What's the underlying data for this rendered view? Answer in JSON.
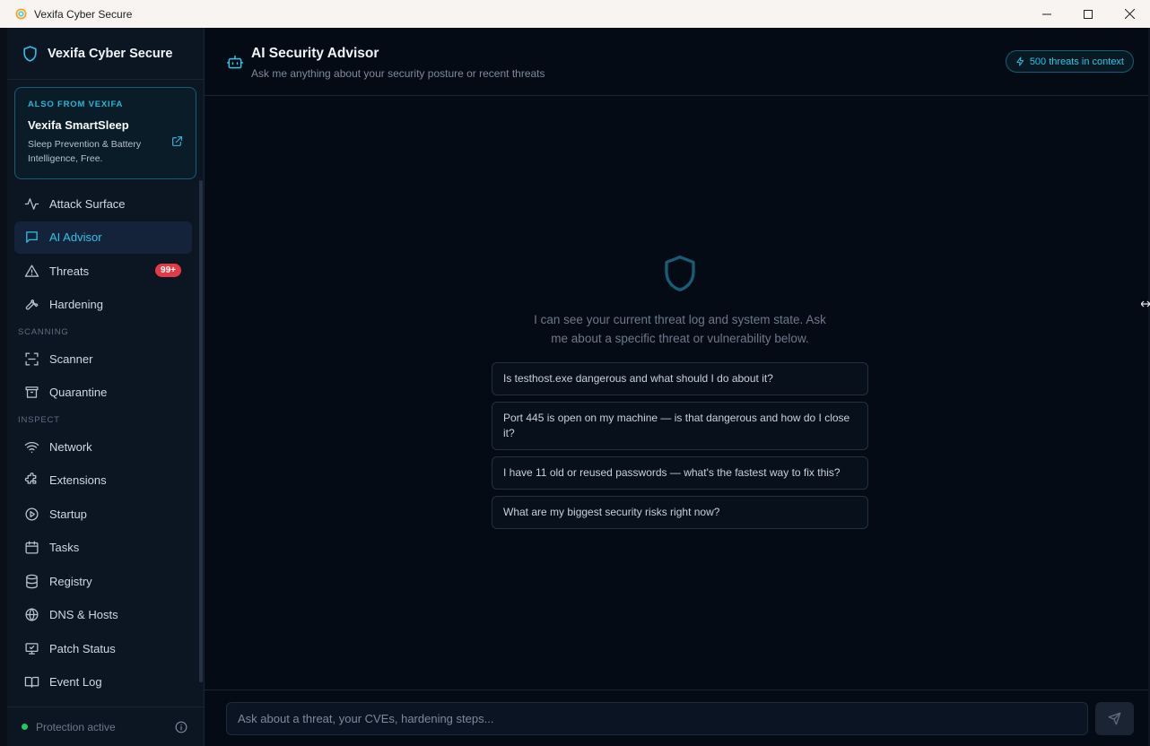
{
  "window": {
    "title": "Vexifa Cyber Secure"
  },
  "sidebar": {
    "brand": "Vexifa Cyber Secure",
    "promo": {
      "eyebrow": "ALSO FROM VEXIFA",
      "title": "Vexifa SmartSleep",
      "description": "Sleep Prevention & Battery Intelligence, Free."
    },
    "items": [
      {
        "label": "Attack Surface",
        "icon": "activity-icon"
      },
      {
        "label": "AI Advisor",
        "icon": "chat-icon",
        "active": true
      },
      {
        "label": "Threats",
        "icon": "warning-icon",
        "badge": "99+"
      },
      {
        "label": "Hardening",
        "icon": "wrench-icon"
      }
    ],
    "sections": {
      "scanning": "SCANNING",
      "inspect": "INSPECT"
    },
    "scanning_items": [
      {
        "label": "Scanner",
        "icon": "scan-icon"
      },
      {
        "label": "Quarantine",
        "icon": "archive-icon"
      }
    ],
    "inspect_items": [
      {
        "label": "Network",
        "icon": "wifi-icon"
      },
      {
        "label": "Extensions",
        "icon": "puzzle-icon"
      },
      {
        "label": "Startup",
        "icon": "play-circle-icon"
      },
      {
        "label": "Tasks",
        "icon": "calendar-icon"
      },
      {
        "label": "Registry",
        "icon": "database-icon"
      },
      {
        "label": "DNS & Hosts",
        "icon": "globe-icon"
      },
      {
        "label": "Patch Status",
        "icon": "monitor-check-icon"
      },
      {
        "label": "Event Log",
        "icon": "book-icon"
      }
    ],
    "footer": {
      "status": "Protection active",
      "status_color": "#22c55e"
    }
  },
  "main": {
    "title": "AI Security Advisor",
    "subtitle": "Ask me anything about your security posture or recent threats",
    "context_pill": "500 threats in context",
    "intro": "I can see your current threat log and system state. Ask me about a specific threat or vulnerability below.",
    "suggestions": [
      "Is testhost.exe dangerous and what should I do about it?",
      "Port 445 is open on my machine — is that dangerous and how do I close it?",
      "I have 11 old or reused passwords — what's the fastest way to fix this?",
      "What are my biggest security risks right now?"
    ],
    "input": {
      "placeholder": "Ask about a threat, your CVEs, hardening steps...",
      "value": ""
    }
  },
  "colors": {
    "accent": "#2ec4e6",
    "badge": "#e23b48",
    "background": "#050b14",
    "sidebar": "#0c1522"
  }
}
